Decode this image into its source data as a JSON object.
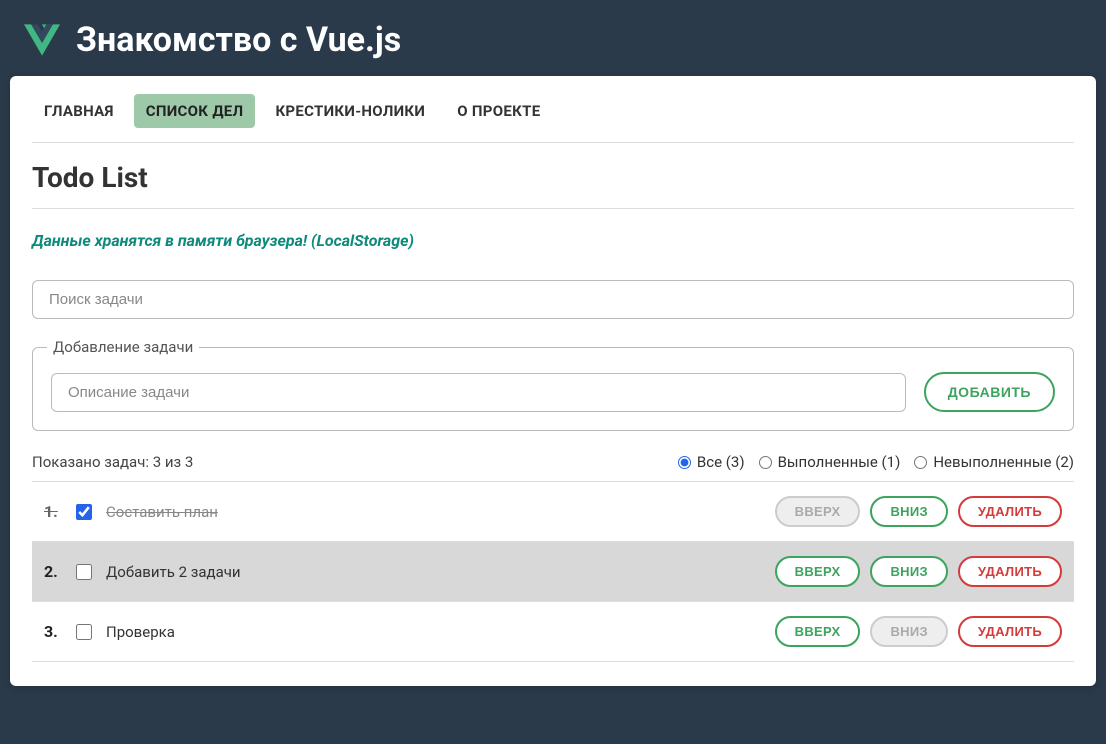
{
  "header": {
    "title": "Знакомство с Vue.js"
  },
  "tabs": [
    {
      "label": "ГЛАВНАЯ",
      "active": false
    },
    {
      "label": "СПИСОК ДЕЛ",
      "active": true
    },
    {
      "label": "КРЕСТИКИ-НОЛИКИ",
      "active": false
    },
    {
      "label": "О ПРОЕКТЕ",
      "active": false
    }
  ],
  "page_title": "Todo List",
  "notice": "Данные хранятся в памяти браузера! (LocalStorage)",
  "search": {
    "placeholder": "Поиск задачи"
  },
  "add": {
    "legend": "Добавление задачи",
    "placeholder": "Описание задачи",
    "button": "ДОБАВИТЬ"
  },
  "stats": "Показано задач: 3 из 3",
  "filters": [
    {
      "label": "Все (3)",
      "checked": true
    },
    {
      "label": "Выполненные (1)",
      "checked": false
    },
    {
      "label": "Невыполненные (2)",
      "checked": false
    }
  ],
  "items": [
    {
      "num": "1.",
      "text": "Составить план",
      "done": true,
      "up_disabled": true,
      "down_disabled": false,
      "highlight": false
    },
    {
      "num": "2.",
      "text": "Добавить 2 задачи",
      "done": false,
      "up_disabled": false,
      "down_disabled": false,
      "highlight": true
    },
    {
      "num": "3.",
      "text": "Проверка",
      "done": false,
      "up_disabled": false,
      "down_disabled": true,
      "highlight": false
    }
  ],
  "buttons": {
    "up": "ВВЕРХ",
    "down": "ВНИЗ",
    "del": "УДАЛИТЬ"
  }
}
